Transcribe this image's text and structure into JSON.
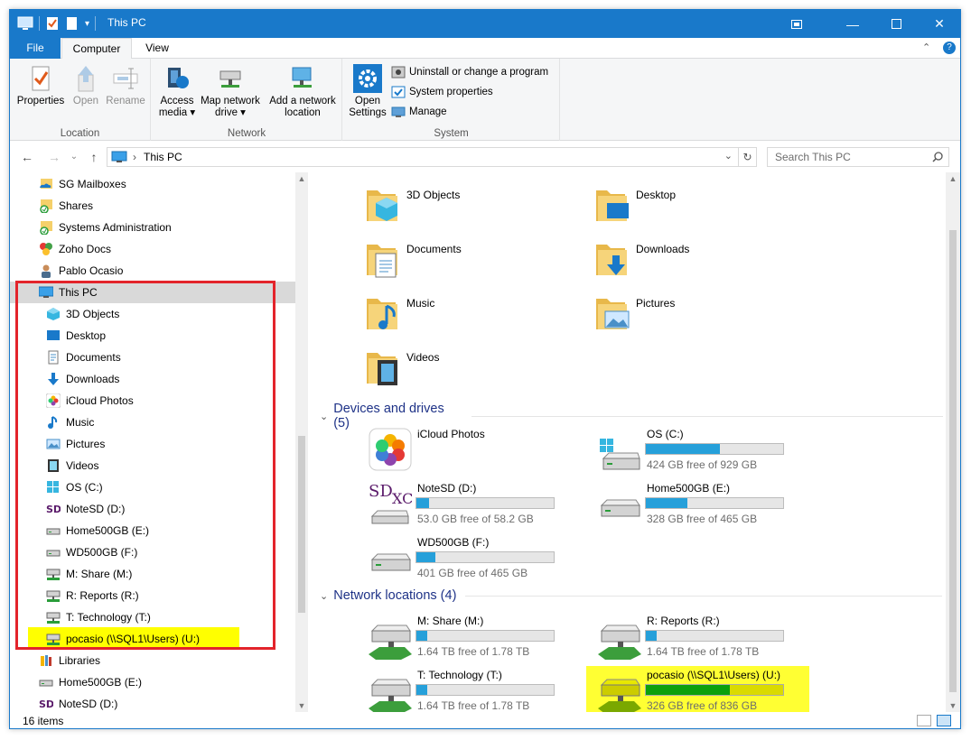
{
  "window": {
    "title": "This PC"
  },
  "ribbon": {
    "tabs": [
      "File",
      "Computer",
      "View"
    ],
    "location": {
      "label": "Location",
      "properties": "Properties",
      "open": "Open",
      "rename": "Rename"
    },
    "network": {
      "label": "Network",
      "access_media_1": "Access",
      "access_media_2": "media ▾",
      "map_drive_1": "Map network",
      "map_drive_2": "drive ▾",
      "add_location_1": "Add a network",
      "add_location_2": "location"
    },
    "system": {
      "label": "System",
      "open_settings_1": "Open",
      "open_settings_2": "Settings",
      "uninstall": "Uninstall or change a program",
      "sys_props": "System properties",
      "manage": "Manage"
    }
  },
  "address": {
    "path": "This PC",
    "search_placeholder": "Search This PC"
  },
  "navpane": {
    "items": [
      {
        "label": "SG Mailboxes",
        "icon": "onedrive-folder-icon"
      },
      {
        "label": "Shares",
        "icon": "synced-folder-icon"
      },
      {
        "label": "Systems Administration",
        "icon": "synced-folder-icon"
      },
      {
        "label": "Zoho Docs",
        "icon": "zoho-icon"
      },
      {
        "label": "Pablo Ocasio",
        "icon": "user-icon"
      },
      {
        "label": "This PC",
        "icon": "computer-icon"
      },
      {
        "label": "3D Objects",
        "icon": "3d-objects-icon"
      },
      {
        "label": "Desktop",
        "icon": "desktop-icon"
      },
      {
        "label": "Documents",
        "icon": "documents-icon"
      },
      {
        "label": "Downloads",
        "icon": "downloads-icon"
      },
      {
        "label": "iCloud Photos",
        "icon": "icloud-photos-icon"
      },
      {
        "label": "Music",
        "icon": "music-icon"
      },
      {
        "label": "Pictures",
        "icon": "pictures-icon"
      },
      {
        "label": "Videos",
        "icon": "videos-icon"
      },
      {
        "label": "OS (C:)",
        "icon": "windows-drive-icon"
      },
      {
        "label": "NoteSD (D:)",
        "icon": "sd-card-icon"
      },
      {
        "label": "Home500GB (E:)",
        "icon": "drive-icon"
      },
      {
        "label": "WD500GB (F:)",
        "icon": "drive-icon"
      },
      {
        "label": "M: Share (M:)",
        "icon": "network-drive-icon"
      },
      {
        "label": "R: Reports (R:)",
        "icon": "network-drive-icon"
      },
      {
        "label": "T: Technology (T:)",
        "icon": "network-drive-icon"
      },
      {
        "label": "pocasio (\\\\SQL1\\Users) (U:)",
        "icon": "network-drive-icon"
      },
      {
        "label": "Libraries",
        "icon": "libraries-icon"
      },
      {
        "label": "Home500GB (E:)",
        "icon": "drive-icon"
      },
      {
        "label": "NoteSD (D:)",
        "icon": "sd-card-icon"
      }
    ]
  },
  "folders": [
    {
      "label": "3D Objects",
      "icon": "3d-objects-folder-icon"
    },
    {
      "label": "Desktop",
      "icon": "desktop-folder-icon"
    },
    {
      "label": "Documents",
      "icon": "documents-folder-icon"
    },
    {
      "label": "Downloads",
      "icon": "downloads-folder-icon"
    },
    {
      "label": "Music",
      "icon": "music-folder-icon"
    },
    {
      "label": "Pictures",
      "icon": "pictures-folder-icon"
    },
    {
      "label": "Videos",
      "icon": "videos-folder-icon"
    }
  ],
  "devices": {
    "header": "Devices and drives (5)",
    "items": [
      {
        "name": "iCloud Photos",
        "free": "",
        "used_fraction": null,
        "icon": "icloud-photos-icon"
      },
      {
        "name": "OS (C:)",
        "free": "424 GB free of 929 GB",
        "used_fraction": 0.54,
        "icon": "windows-drive-icon"
      },
      {
        "name": "NoteSD (D:)",
        "free": "53.0 GB free of 58.2 GB",
        "used_fraction": 0.09,
        "icon": "sd-card-icon"
      },
      {
        "name": "Home500GB (E:)",
        "free": "328 GB free of 465 GB",
        "used_fraction": 0.3,
        "icon": "drive-icon"
      },
      {
        "name": "WD500GB (F:)",
        "free": "401 GB free of 465 GB",
        "used_fraction": 0.14,
        "icon": "drive-icon"
      }
    ]
  },
  "network": {
    "header": "Network locations (4)",
    "items": [
      {
        "name": "M: Share (M:)",
        "free": "1.64 TB free of 1.78 TB",
        "used_fraction": 0.08,
        "icon": "network-drive-icon"
      },
      {
        "name": "R: Reports (R:)",
        "free": "1.64 TB free of 1.78 TB",
        "used_fraction": 0.08,
        "icon": "network-drive-icon"
      },
      {
        "name": "T: Technology (T:)",
        "free": "1.64 TB free of 1.78 TB",
        "used_fraction": 0.08,
        "icon": "network-drive-icon"
      },
      {
        "name": "pocasio (\\\\SQL1\\Users) (U:)",
        "free": "326 GB free of 836 GB",
        "used_fraction": 0.61,
        "icon": "network-drive-icon"
      }
    ]
  },
  "status": {
    "count": "16 items"
  },
  "colors": {
    "accent": "#1979ca",
    "bar_fill": "#26a0da",
    "bar_fill_highlight": "#0ca00c",
    "highlight_yellow": "#ffff00",
    "highlight_red": "#e3242b"
  }
}
